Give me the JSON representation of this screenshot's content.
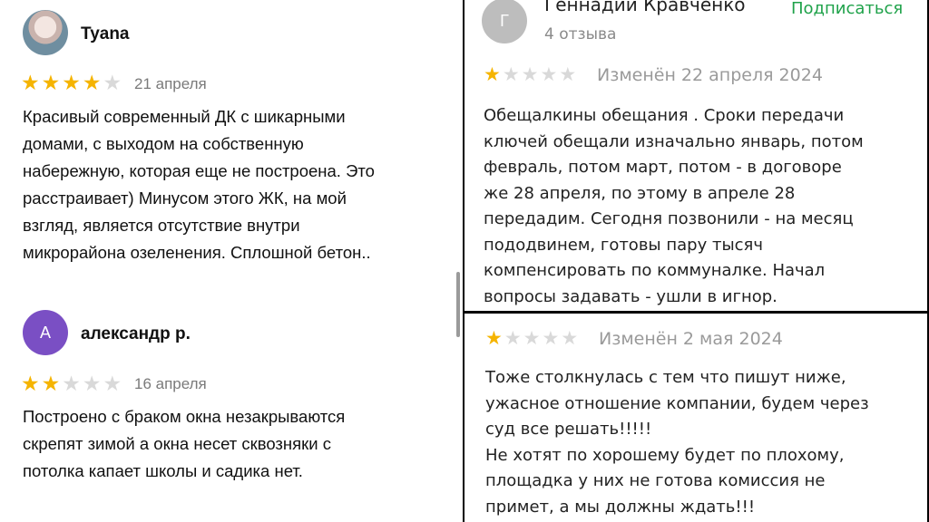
{
  "left_panel": {
    "review1": {
      "author": "Tyana",
      "rating": 4,
      "date": "21 апреля",
      "text": "Красивый современный ДК с шикарными\nдомами, с выходом на собственную\nнабережную, которая еще не построена. Это\nрасстраивает) Минусом этого ЖК, на мой\nвзгляд, является отсутствие внутри\nмикрорайона озеленения. Сплошной бетон.."
    },
    "review2": {
      "author": "александр р.",
      "avatar_letter": "А",
      "avatar_color": "#7a4fc4",
      "rating": 2,
      "date": "16 апреля",
      "text": "Построено с браком окна незакрываются\nскрепят зимой а окна несет  сквозняки с\nпотолка капает школы и садика нет."
    }
  },
  "right_top": {
    "author": "Геннадий Кравченко",
    "avatar_letter": "Г",
    "avatar_color": "#bdbdbd",
    "reviews_count": "4 отзыва",
    "subscribe_label": "Подписаться",
    "rating": 1,
    "date": "Изменён 22 апреля 2024",
    "text": "Обещалкины обещания . Сроки передачи\nключей обещали изначально январь, потом\nфевраль, потом март, потом - в договоре\nже 28 апреля, по этому в апреле 28\nпередадим. Сегодня позвонили - на месяц\nпододвинем, готовы пару тысяч\nкомпенсировать по коммуналке. Начал\nвопросы задавать - ушли в игнор."
  },
  "right_bottom": {
    "rating": 1,
    "date": "Изменён 2 мая 2024",
    "text": "Тоже столкнулась с тем что пишут ниже,\nужасное отношение компании, будем через\nсуд все решать!!!!!\nНе хотят по хорошему будет по плохому,\nплощадка у них не готова комиссия не\nпримет, а мы должны ждать!!!"
  },
  "colors": {
    "star_on": "#f5b400",
    "star_off": "#d9d9d9",
    "subscribe": "#1fa24a"
  }
}
